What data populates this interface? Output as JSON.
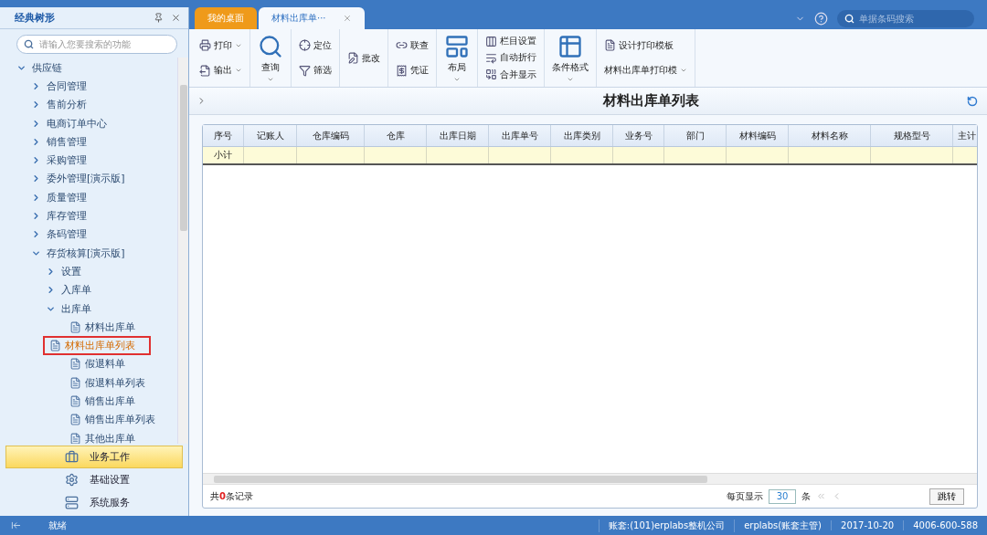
{
  "sidebar": {
    "title": "经典树形",
    "search": {
      "placeholder": "请输入您要搜索的功能"
    },
    "tree": [
      {
        "label": "供应链",
        "expanded": true,
        "children": [
          {
            "label": "合同管理",
            "expanded": false
          },
          {
            "label": "售前分析",
            "expanded": false
          },
          {
            "label": "电商订单中心",
            "expanded": false
          },
          {
            "label": "销售管理",
            "expanded": false
          },
          {
            "label": "采购管理",
            "expanded": false
          },
          {
            "label": "委外管理[演示版]",
            "expanded": false
          },
          {
            "label": "质量管理",
            "expanded": false
          },
          {
            "label": "库存管理",
            "expanded": false
          },
          {
            "label": "条码管理",
            "expanded": false
          },
          {
            "label": "存货核算[演示版]",
            "expanded": true,
            "children": [
              {
                "label": "设置",
                "expanded": false
              },
              {
                "label": "入库单",
                "expanded": false
              },
              {
                "label": "出库单",
                "expanded": true,
                "children": [
                  {
                    "label": "材料出库单",
                    "kind": "doc",
                    "selected": false
                  },
                  {
                    "label": "材料出库单列表",
                    "kind": "doc",
                    "selected": true
                  },
                  {
                    "label": "假退料单",
                    "kind": "doc",
                    "selected": false
                  },
                  {
                    "label": "假退料单列表",
                    "kind": "doc",
                    "selected": false
                  },
                  {
                    "label": "销售出库单",
                    "kind": "doc",
                    "selected": false
                  },
                  {
                    "label": "销售出库单列表",
                    "kind": "doc",
                    "selected": false
                  },
                  {
                    "label": "其他出库单",
                    "kind": "doc",
                    "selected": false
                  }
                ]
              }
            ]
          }
        ]
      }
    ],
    "nav": [
      {
        "label": "业务工作",
        "selected": true
      },
      {
        "label": "基础设置",
        "selected": false
      },
      {
        "label": "系统服务",
        "selected": false
      }
    ]
  },
  "tabs": [
    {
      "label": "我的桌面",
      "selected": false,
      "closable": false
    },
    {
      "label": "材料出库单···",
      "selected": true,
      "closable": true
    }
  ],
  "top_search": {
    "placeholder": "单据条码搜索"
  },
  "toolbar": [
    {
      "kind": "stack",
      "items": [
        {
          "label": "打印",
          "dropdown": true
        },
        {
          "label": "输出",
          "dropdown": true
        }
      ]
    },
    {
      "kind": "big",
      "label": "查询",
      "dropdown": true
    },
    {
      "kind": "stack",
      "items": [
        {
          "label": "定位",
          "dropdown": false
        },
        {
          "label": "筛选",
          "dropdown": false
        }
      ]
    },
    {
      "kind": "stack",
      "items": [
        {
          "label": "批改",
          "dropdown": false
        }
      ]
    },
    {
      "kind": "stack",
      "items": [
        {
          "label": "联查",
          "dropdown": false
        },
        {
          "label": "凭证",
          "dropdown": false
        }
      ]
    },
    {
      "kind": "big",
      "label": "布局",
      "dropdown": true
    },
    {
      "kind": "stack",
      "items": [
        {
          "label": "栏目设置",
          "dropdown": false
        },
        {
          "label": "自动折行",
          "dropdown": false
        },
        {
          "label": "合并显示",
          "dropdown": false
        }
      ]
    },
    {
      "kind": "big",
      "label": "条件格式",
      "dropdown": true
    },
    {
      "kind": "stack",
      "items": [
        {
          "label": "设计打印模板",
          "dropdown": false
        },
        {
          "label": "材料出库单打印模",
          "dropdown": true
        }
      ]
    }
  ],
  "page_title": "材料出库单列表",
  "table": {
    "columns": [
      "序号",
      "记账人",
      "仓库编码",
      "仓库",
      "出库日期",
      "出库单号",
      "出库类别",
      "业务号",
      "部门",
      "材料编码",
      "材料名称",
      "规格型号",
      "主计"
    ],
    "rows": [
      [
        "小计",
        "",
        "",
        "",
        "",
        "",
        "",
        "",
        "",
        "",
        "",
        "",
        ""
      ]
    ]
  },
  "footer": {
    "record_prefix": "共",
    "record_count": "0",
    "record_suffix": "条记录",
    "page_size_label": "每页显示",
    "page_size": "30",
    "page_size_unit": "条",
    "jump_button": "跳转"
  },
  "status_bar": {
    "state": "就绪",
    "account": "账套:(101)erplabs整机公司",
    "user": "erplabs(账套主管)",
    "date": "2017-10-20",
    "phone": "4006-600-588"
  }
}
